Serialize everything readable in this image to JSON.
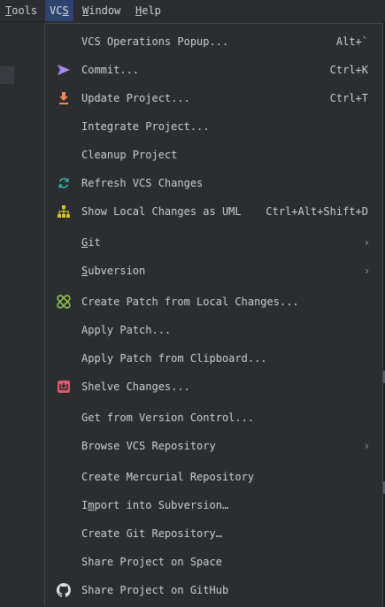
{
  "menubar": {
    "tools": "Tools",
    "vcs": "VCS",
    "window": "Window",
    "help": "Help"
  },
  "menu": {
    "items": [
      {
        "label": "VCS Operations Popup...",
        "shortcut": "Alt+`",
        "icon": "none"
      },
      {
        "label": "Commit...",
        "shortcut": "Ctrl+K",
        "icon": "commit-arrow-icon"
      },
      {
        "label": "Update Project...",
        "shortcut": "Ctrl+T",
        "icon": "update-download-icon"
      },
      {
        "label": "Integrate Project...",
        "shortcut": "",
        "icon": "none"
      },
      {
        "label": "Cleanup Project",
        "shortcut": "",
        "icon": "none"
      },
      {
        "label": "Refresh VCS Changes",
        "shortcut": "",
        "icon": "refresh-icon"
      },
      {
        "label": "Show Local Changes as UML",
        "shortcut": "Ctrl+Alt+Shift+D",
        "icon": "uml-diagram-icon"
      },
      {
        "label": "Git",
        "shortcut": "",
        "icon": "none",
        "submenu": true
      },
      {
        "label": "Subversion",
        "shortcut": "",
        "icon": "none",
        "submenu": true
      },
      {
        "label": "Create Patch from Local Changes...",
        "shortcut": "",
        "icon": "patch-icon"
      },
      {
        "label": "Apply Patch...",
        "shortcut": "",
        "icon": "none"
      },
      {
        "label": "Apply Patch from Clipboard...",
        "shortcut": "",
        "icon": "none"
      },
      {
        "label": "Shelve Changes...",
        "shortcut": "",
        "icon": "shelve-icon"
      },
      {
        "label": "Get from Version Control...",
        "shortcut": "",
        "icon": "none"
      },
      {
        "label": "Browse VCS Repository",
        "shortcut": "",
        "icon": "none",
        "submenu": true
      },
      {
        "label": "Create Mercurial Repository",
        "shortcut": "",
        "icon": "none"
      },
      {
        "label": "Import into Subversion…",
        "shortcut": "",
        "icon": "none"
      },
      {
        "label": "Create Git Repository…",
        "shortcut": "",
        "icon": "none"
      },
      {
        "label": "Share Project on Space",
        "shortcut": "",
        "icon": "none"
      },
      {
        "label": "Share Project on GitHub",
        "shortcut": "",
        "icon": "github-icon"
      }
    ],
    "submenu_arrow": "›"
  },
  "colors": {
    "background": "#2b2d30",
    "text": "#c9ccd2",
    "active_menu": "#2e436e",
    "commit_icon": "#b189f5",
    "update_icon": "#f0875b",
    "refresh_icon": "#2fb5a5",
    "uml_icon": "#d6c81f",
    "patch_icon": "#8fc44f",
    "shelve_icon": "#e55765",
    "arrow": "#6e9fd6"
  }
}
